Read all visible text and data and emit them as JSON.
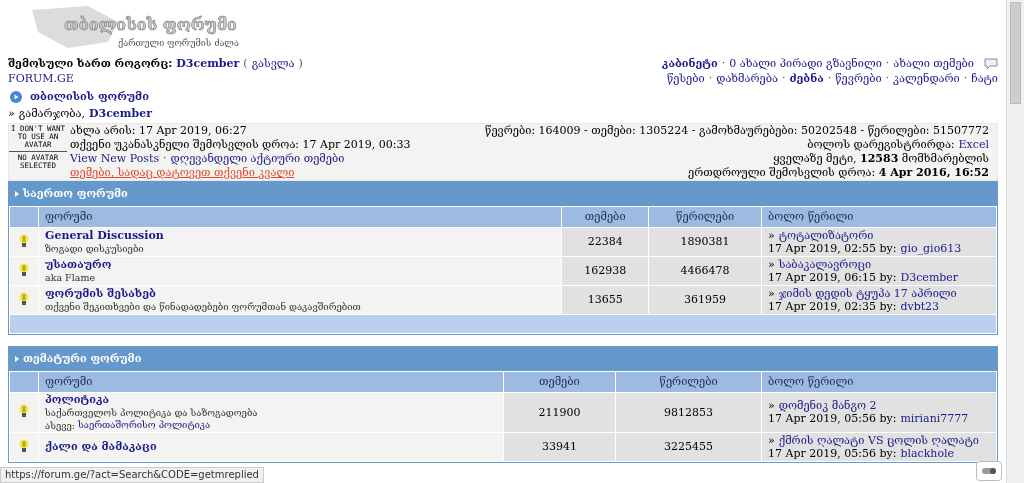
{
  "logo": {
    "title": "თბილისის ფორუმი",
    "subtitle": "ქართული ფორუმის ძალა"
  },
  "separator": "·",
  "login": {
    "label": "შემოსული ხართ როგორც:",
    "user": "D3cember",
    "logout_open": "(",
    "logout": "გასვლა",
    "logout_close": ")"
  },
  "site_link": "FORUM.GE",
  "user_menu": {
    "cabinet": "კაბინეტი",
    "links": [
      "0 ახალი პირადი გზავნილი",
      "ახალი თემები"
    ]
  },
  "nav_links": [
    {
      "label": "წესები",
      "selected": false
    },
    {
      "label": "დახმარება",
      "selected": false
    },
    {
      "label": "ძებნა",
      "selected": true
    },
    {
      "label": "წევრები",
      "selected": false
    },
    {
      "label": "კალენდარი",
      "selected": false
    },
    {
      "label": "ჩატი",
      "selected": false
    }
  ],
  "forum_title": "თბილისის ფორუმი",
  "breadcrumb": {
    "marker": "»",
    "greeting": "გამარჯობა,",
    "user": "D3cember"
  },
  "last_post_marker": "»",
  "avatar": {
    "top": "I DON'T WANT TO USE AN AVATAR",
    "bottom": "NO AVATAR SELECTED"
  },
  "info": {
    "now": "ახლა არის: 17 Apr 2019, 06:27",
    "last_visit": "თქვენი უკანასკნელი შემოსვლის დროა: 17 Apr 2019, 00:33",
    "links": [
      "View New Posts",
      "დღევანდელი აქტიური თემები"
    ],
    "replied_link": "თემები, სადაც დატოვეთ თქვენი კვალი"
  },
  "stats": {
    "totals": "წევრები: 164009 - თემები: 1305224 - გამოხმაურებები: 50202548 - წერილები: 51507772",
    "last_registered_label": "ბოლოს დარეგისტრირდა:",
    "last_registered": "Excel",
    "record_prefix": "ყველაზე მეტი,",
    "record_count": "12583",
    "record_suffix": "მომხმარებლის",
    "record_time_label": "ერთდროული შემოსვლის დროა:",
    "record_time": "4 Apr 2016, 16:52"
  },
  "sections": [
    {
      "title": "საერთო ფორუმი",
      "columns": [
        "ფორუმი",
        "თემები",
        "წერილები",
        "ბოლო წერილი"
      ],
      "footer": true,
      "rows": [
        {
          "name": "General Discussion",
          "description": [
            "ზოგადი დისკუსიები"
          ],
          "topics": "22384",
          "posts": "1890381",
          "last_title": "ტოტალიზატორი",
          "last_date": "17 Apr 2019, 02:55 by:",
          "last_user": "gio_gio613"
        },
        {
          "name": "უსათაურო",
          "description": [
            "aka Flame"
          ],
          "topics": "162938",
          "posts": "4466478",
          "last_title": "საბაკალავროცი",
          "last_date": "17 Apr 2019, 06:15 by:",
          "last_user": "D3cember"
        },
        {
          "name": "ფორუმის შესახებ",
          "description": [
            "თქვენი შეკითხვები და წინადადებები ფორუმთან დაკავშირებით"
          ],
          "topics": "13655",
          "posts": "361959",
          "last_title": "ჯიმის დედის ტყუპა 17 აპრილი",
          "last_date": "17 Apr 2019, 02:35 by:",
          "last_user": "dvbt23"
        }
      ]
    },
    {
      "title": "თემატური ფორუმი",
      "columns": [
        "ფორუმი",
        "თემები",
        "წერილები",
        "ბოლო წერილი"
      ],
      "footer": false,
      "rows": [
        {
          "name": "პოლიტიკა",
          "description": [
            "საქართველოს პოლიტიკა და საზოგადოება"
          ],
          "also_label": "ასევე:",
          "also_link": "საერთაშორისო პოლიტიკა",
          "topics": "211900",
          "posts": "9812853",
          "last_title": "დომენიკ მანგო 2",
          "last_date": "17 Apr 2019, 05:56 by:",
          "last_user": "miriani7777"
        },
        {
          "name": "ქალი და მამაკაცი",
          "description": [],
          "topics": "33941",
          "posts": "3225455",
          "last_title": "ქმრის ღალატი VS ცოლის ღალატი",
          "last_date": "17 Apr 2019, 05:56 by:",
          "last_user": "blackhole"
        }
      ]
    }
  ],
  "status_url": "https://forum.ge/?act=Search&CODE=getmreplied"
}
